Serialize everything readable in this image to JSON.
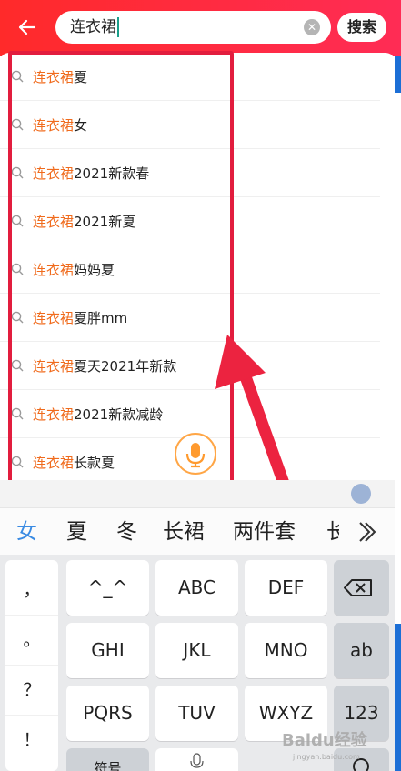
{
  "header": {
    "search_query": "连衣裙",
    "search_button_label": "搜索"
  },
  "suggestions": [
    {
      "highlight": "连衣裙",
      "rest": "夏"
    },
    {
      "highlight": "连衣裙",
      "rest": "女"
    },
    {
      "highlight": "连衣裙",
      "rest": "2021新款春"
    },
    {
      "highlight": "连衣裙",
      "rest": "2021新夏"
    },
    {
      "highlight": "连衣裙",
      "rest": "妈妈夏"
    },
    {
      "highlight": "连衣裙",
      "rest": "夏胖mm"
    },
    {
      "highlight": "连衣裙",
      "rest": "夏天2021年新款"
    },
    {
      "highlight": "连衣裙",
      "rest": "2021新款减龄"
    },
    {
      "highlight": "连衣裙",
      "rest": "长款夏"
    }
  ],
  "candidates": [
    "女",
    "夏",
    "冬",
    "长裙",
    "两件套",
    "长"
  ],
  "keyboard": {
    "punctuation": [
      "，",
      "。",
      "？",
      "！"
    ],
    "rows": [
      [
        "^_^",
        "ABC",
        "DEF"
      ],
      [
        "GHI",
        "JKL",
        "MNO"
      ],
      [
        "PQRS",
        "TUV",
        "WXYZ"
      ],
      [
        "符号",
        "",
        ""
      ]
    ],
    "side_keys": [
      "ab",
      "123"
    ]
  },
  "watermark": {
    "brand": "Baidu经验",
    "url": "jingyan.baidu.com"
  },
  "colors": {
    "header_red": "#ff2a2a",
    "highlight_orange": "#f06b1d",
    "candidate_active": "#3a8be3",
    "annotation_red": "#e21d3e"
  }
}
